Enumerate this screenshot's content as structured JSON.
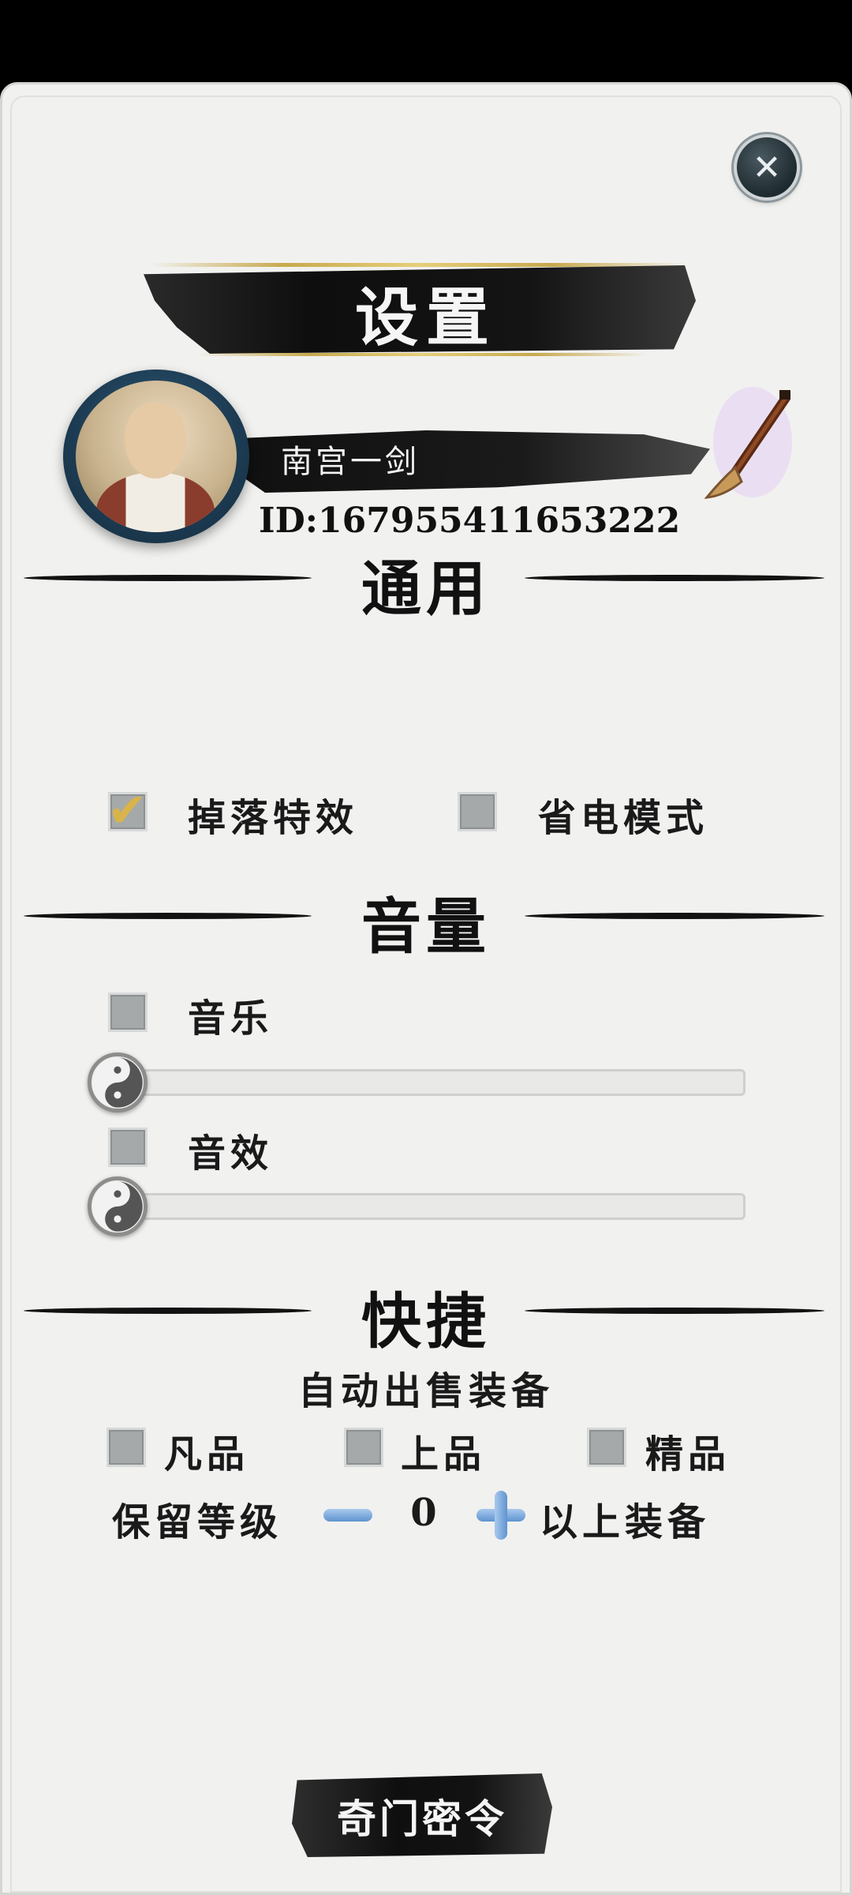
{
  "header": {
    "title": "设置",
    "close_icon": "close-icon"
  },
  "profile": {
    "name": "南宫一剑",
    "id_text": "ID:167955411653222",
    "avatar_icon": "monk-avatar",
    "edit_icon": "brush-icon"
  },
  "general": {
    "title": "通用",
    "options": [
      {
        "label": "掉落特效",
        "checked": true
      },
      {
        "label": "省电模式",
        "checked": false
      }
    ]
  },
  "volume": {
    "title": "音量",
    "music": {
      "label": "音乐",
      "checked": false,
      "level": 0
    },
    "sfx": {
      "label": "音效",
      "checked": false,
      "level": 0
    }
  },
  "shortcut": {
    "title": "快捷",
    "auto_sell_label": "自动出售装备",
    "grades": [
      {
        "label": "凡品",
        "checked": false
      },
      {
        "label": "上品",
        "checked": false
      },
      {
        "label": "精品",
        "checked": false
      }
    ],
    "keep_level_label": "保留等级",
    "keep_level_value": "0",
    "above_label": "以上装备"
  },
  "footer": {
    "secret_button": "奇门密令"
  },
  "colors": {
    "ink": "#121212",
    "panel": "#f1f1ef",
    "gold": "#d8b44a",
    "stepper_blue": "#6a9fd8"
  }
}
